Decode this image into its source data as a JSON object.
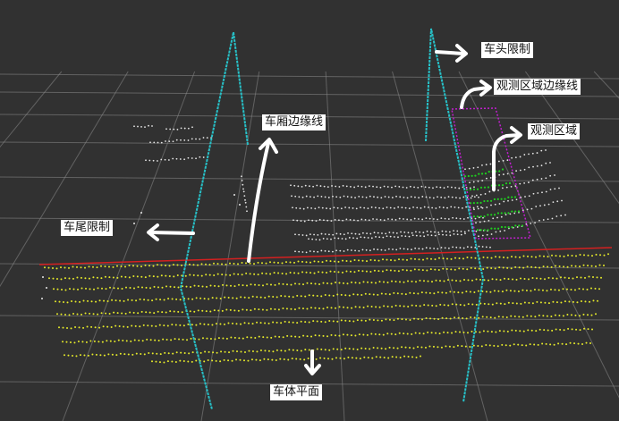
{
  "scene": {
    "background": "#313131",
    "grid_color": "#8a8a8a",
    "colors": {
      "compartment_edge": "#27c1c8",
      "observation_border": "#c21fd0",
      "observation_points": "#1fd01f",
      "body_plane_points": "#e6ea2a",
      "scan_points": "#e8e8e8",
      "tail_line": "#d42020",
      "arrow": "#ffffff"
    }
  },
  "labels": {
    "head_limit": "车头限制",
    "observation_edge": "观测区域边缘线",
    "compartment_edge": "车厢边缘线",
    "observation_area": "观测区域",
    "tail_limit": "车尾限制",
    "body_plane": "车体平面"
  }
}
